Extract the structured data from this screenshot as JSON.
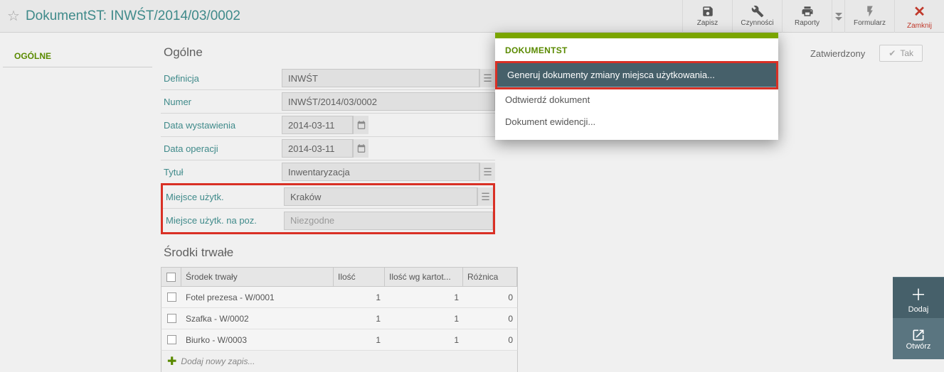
{
  "header": {
    "title": "DokumentST: INWŚT/2014/03/0002"
  },
  "toolbar": {
    "save": "Zapisz",
    "actions": "Czynności",
    "reports": "Raporty",
    "form": "Formularz",
    "close": "Zamknij"
  },
  "sidebar": {
    "tab_general": "OGÓLNE"
  },
  "status": {
    "label": "Zatwierdzony",
    "value": "Tak"
  },
  "panel": {
    "general_title": "Ogólne",
    "fields": {
      "definicja_lbl": "Definicja",
      "definicja_val": "INWŚT",
      "numer_lbl": "Numer",
      "numer_val": "INWŚT/2014/03/0002",
      "data_wyst_lbl": "Data wystawienia",
      "data_wyst_val": "2014-03-11",
      "data_oper_lbl": "Data operacji",
      "data_oper_val": "2014-03-11",
      "tytul_lbl": "Tytuł",
      "tytul_val": "Inwentaryzacja",
      "miejsce_lbl": "Miejsce użytk.",
      "miejsce_val": "Kraków",
      "miejsce_poz_lbl": "Miejsce użytk. na poz.",
      "miejsce_poz_val": "Niezgodne"
    }
  },
  "assets": {
    "title": "Środki trwałe",
    "columns": {
      "name": "Środek trwały",
      "qty": "Ilość",
      "qty_card": "Ilość wg kartot...",
      "diff": "Różnica"
    },
    "rows": [
      {
        "name": "Fotel prezesa - W/0001",
        "qty": "1",
        "qty_card": "1",
        "diff": "0"
      },
      {
        "name": "Szafka - W/0002",
        "qty": "1",
        "qty_card": "1",
        "diff": "0"
      },
      {
        "name": "Biurko - W/0003",
        "qty": "1",
        "qty_card": "1",
        "diff": "0"
      }
    ],
    "add_text": "Dodaj nowy zapis..."
  },
  "dropdown": {
    "header": "DOKUMENTST",
    "items": {
      "gen": "Generuj dokumenty zmiany miejsca użytkowania...",
      "odt": "Odtwierdź dokument",
      "ewid": "Dokument ewidencji..."
    }
  },
  "right_actions": {
    "add": "Dodaj",
    "open": "Otwórz"
  }
}
